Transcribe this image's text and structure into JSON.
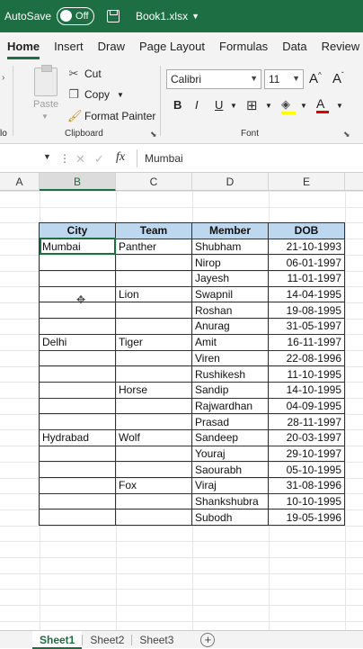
{
  "titlebar": {
    "autosave": "AutoSave",
    "toggle_state": "Off",
    "filename": "Book1.xlsx",
    "chevron": "⌄"
  },
  "tabs": [
    "Home",
    "Insert",
    "Draw",
    "Page Layout",
    "Formulas",
    "Data",
    "Review"
  ],
  "ribbon": {
    "clipboard": {
      "paste": "Paste",
      "cut": "Cut",
      "copy": "Copy",
      "format_painter": "Format Painter",
      "group_label": "Clipboard"
    },
    "font": {
      "name": "Calibri",
      "size": "11",
      "grow": "A^",
      "shrink": "Aˇ",
      "bold": "B",
      "italic": "I",
      "underline": "U",
      "group_label": "Font"
    },
    "left_edge_label": "lo"
  },
  "formula_bar": {
    "fx": "fx",
    "value": "Mumbai"
  },
  "columns": [
    "A",
    "B",
    "C",
    "D",
    "E"
  ],
  "table": {
    "headers": [
      "City",
      "Team",
      "Member",
      "DOB"
    ],
    "rows": [
      [
        "Mumbai",
        "Panther",
        "Shubham",
        "21-10-1993"
      ],
      [
        "",
        "",
        "Nirop",
        "06-01-1997"
      ],
      [
        "",
        "",
        "Jayesh",
        "11-01-1997"
      ],
      [
        "",
        "Lion",
        "Swapnil",
        "14-04-1995"
      ],
      [
        "",
        "",
        "Roshan",
        "19-08-1995"
      ],
      [
        "",
        "",
        "Anurag",
        "31-05-1997"
      ],
      [
        "Delhi",
        "Tiger",
        "Amit",
        "16-11-1997"
      ],
      [
        "",
        "",
        "Viren",
        "22-08-1996"
      ],
      [
        "",
        "",
        "Rushikesh",
        "11-10-1995"
      ],
      [
        "",
        "Horse",
        "Sandip",
        "14-10-1995"
      ],
      [
        "",
        "",
        "Rajwardhan",
        "04-09-1995"
      ],
      [
        "",
        "",
        "Prasad",
        "28-11-1997"
      ],
      [
        "Hydrabad",
        "Wolf",
        "Sandeep",
        "20-03-1997"
      ],
      [
        "",
        "",
        "Youraj",
        "29-10-1997"
      ],
      [
        "",
        "",
        "Saourabh",
        "05-10-1995"
      ],
      [
        "",
        "Fox",
        "Viraj",
        "31-08-1996"
      ],
      [
        "",
        "",
        "Shankshubra",
        "10-10-1995"
      ],
      [
        "",
        "",
        "Subodh",
        "19-05-1996"
      ]
    ]
  },
  "sheets": [
    "Sheet1",
    "Sheet2",
    "Sheet3"
  ],
  "colors": {
    "accent": "#1e6e43",
    "header_fill": "#bdd7ee"
  }
}
